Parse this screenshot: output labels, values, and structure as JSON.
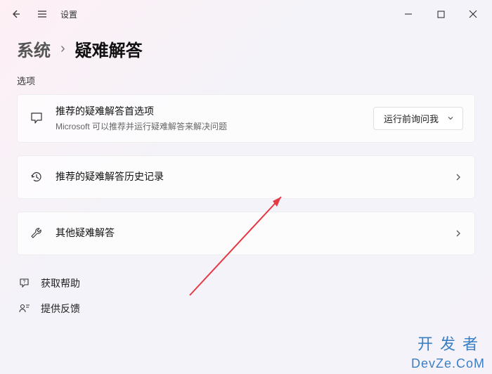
{
  "titlebar": {
    "app_label": "设置"
  },
  "breadcrumb": {
    "parent": "系统",
    "separator": "›",
    "current": "疑难解答"
  },
  "section": {
    "label": "选项"
  },
  "cards": {
    "preferred": {
      "title": "推荐的疑难解答首选项",
      "subtitle": "Microsoft 可以推荐并运行疑难解答来解决问题",
      "dropdown_value": "运行前询问我"
    },
    "history": {
      "title": "推荐的疑难解答历史记录"
    },
    "other": {
      "title": "其他疑难解答"
    }
  },
  "links": {
    "help": "获取帮助",
    "feedback": "提供反馈"
  },
  "watermark": {
    "cn": "开发者",
    "en": "DevZe.CoM"
  }
}
